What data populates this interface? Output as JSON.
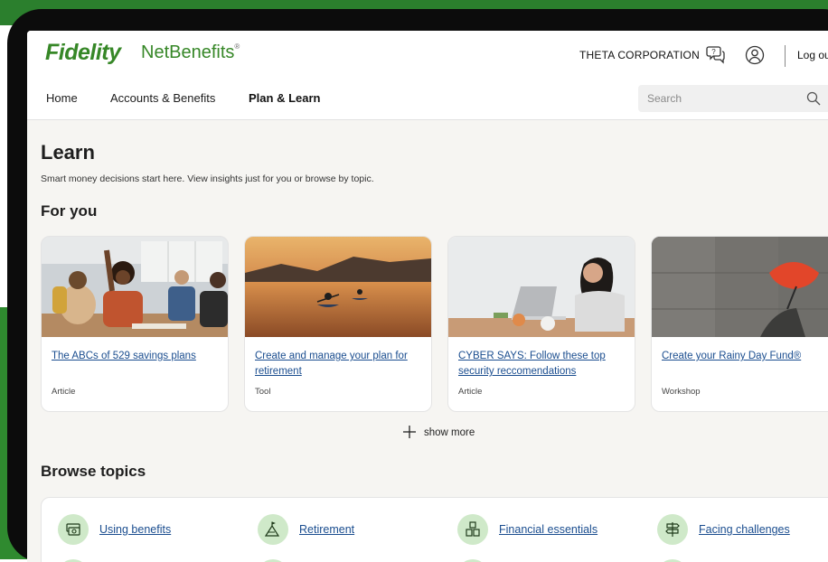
{
  "brand": {
    "name": "Fidelity",
    "product": "NetBenefits",
    "mark": "®"
  },
  "header": {
    "company": "THETA CORPORATION",
    "logout_label": "Log out"
  },
  "nav": {
    "items": [
      {
        "label": "Home",
        "active": false
      },
      {
        "label": "Accounts & Benefits",
        "active": false
      },
      {
        "label": "Plan & Learn",
        "active": true
      }
    ],
    "search_placeholder": "Search"
  },
  "learn": {
    "title": "Learn",
    "subtitle": "Smart money decisions start here. View insights just for you or browse by topic.",
    "for_you_heading": "For you",
    "cards": [
      {
        "title": "The ABCs of 529 savings plans",
        "type": "Article",
        "image": "classroom-photo"
      },
      {
        "title": "Create and manage your plan for retirement",
        "type": "Tool",
        "image": "kayak-sunset-photo"
      },
      {
        "title": "CYBER SAYS: Follow these top security reccomendations",
        "type": "Article",
        "image": "laptop-woman-photo"
      },
      {
        "title": "Create your Rainy Day Fund®",
        "type": "Workshop",
        "image": "red-umbrella-photo"
      }
    ],
    "show_more_label": "show more",
    "browse_heading": "Browse topics",
    "topics": [
      {
        "label": "Using benefits",
        "icon": "money-bills-icon"
      },
      {
        "label": "Retirement",
        "icon": "mountain-flag-icon"
      },
      {
        "label": "Financial essentials",
        "icon": "blocks-icon"
      },
      {
        "label": "Facing challenges",
        "icon": "signpost-icon"
      }
    ]
  },
  "colors": {
    "brand_green": "#368727",
    "link_blue": "#1a4d8f",
    "topic_circle": "#cfe9c9"
  }
}
